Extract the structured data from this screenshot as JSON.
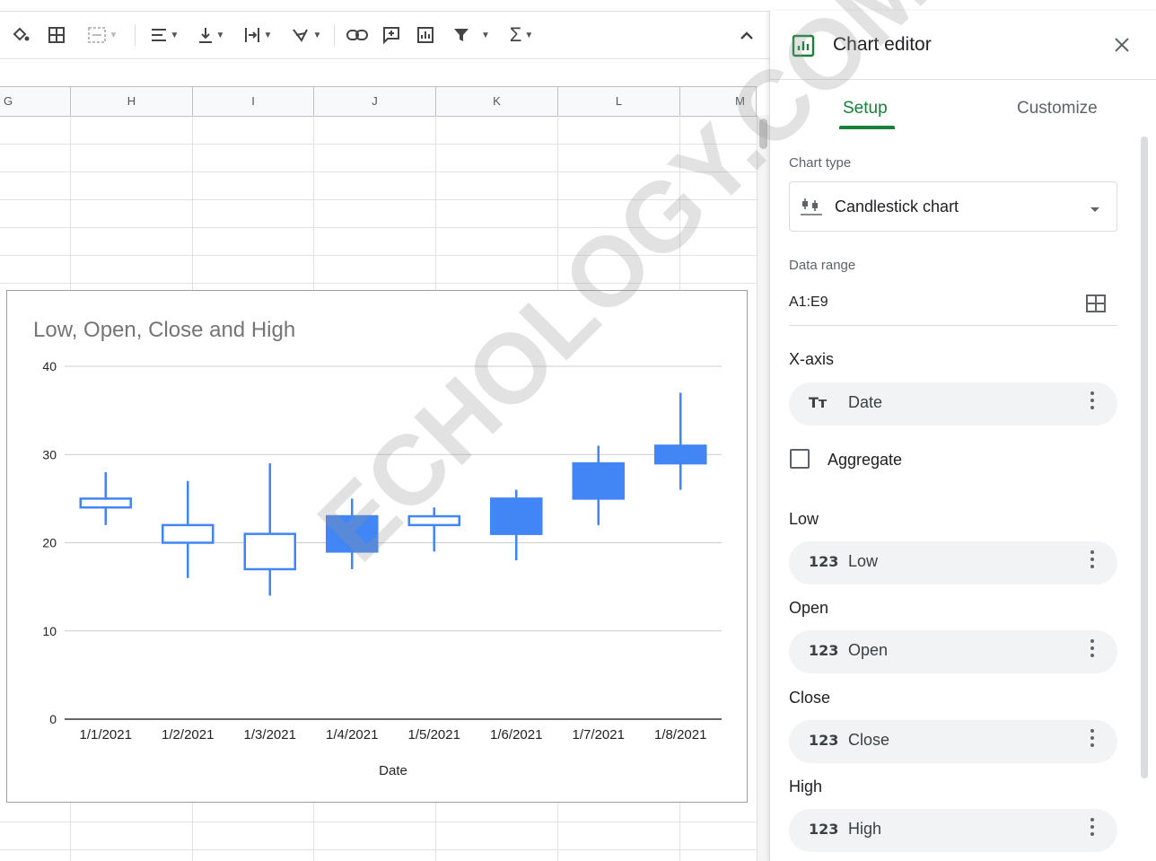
{
  "toolbar": {
    "icons": [
      "fill-color-icon",
      "borders-icon",
      "merge-cells-icon",
      "horizontal-align-icon",
      "vertical-align-icon",
      "text-wrap-icon",
      "text-rotation-icon",
      "insert-link-icon",
      "insert-comment-icon",
      "insert-chart-icon",
      "filter-icon",
      "functions-icon",
      "collapse-chevron-icon"
    ]
  },
  "columns": [
    "G",
    "H",
    "I",
    "J",
    "K",
    "L",
    "M"
  ],
  "chart": {
    "title": "Low, Open, Close and High",
    "xlabel": "Date",
    "accent": "#4285f4"
  },
  "chart_data": {
    "type": "candlestick",
    "title": "Low, Open, Close and High",
    "xlabel": "Date",
    "ylabel": "",
    "ylim": [
      0,
      40
    ],
    "yticks": [
      0,
      10,
      20,
      30,
      40
    ],
    "categories": [
      "1/1/2021",
      "1/2/2021",
      "1/3/2021",
      "1/4/2021",
      "1/5/2021",
      "1/6/2021",
      "1/7/2021",
      "1/8/2021"
    ],
    "low": [
      22,
      16,
      14,
      17,
      19,
      18,
      22,
      26
    ],
    "open": [
      25,
      22,
      21,
      19,
      23,
      21,
      25,
      29
    ],
    "close": [
      24,
      20,
      17,
      23,
      22,
      25,
      29,
      31
    ],
    "high": [
      28,
      27,
      29,
      25,
      24,
      26,
      31,
      37
    ],
    "grid": true,
    "legend": "none"
  },
  "panel": {
    "title": "Chart editor",
    "tabs": [
      "Setup",
      "Customize"
    ],
    "active_tab": "Setup",
    "accent": "#188038",
    "chart_type_label": "Chart type",
    "chart_type_value": "Candlestick chart",
    "data_range_label": "Data range",
    "data_range_value": "A1:E9",
    "xaxis_label": "X-axis",
    "xaxis_chip": "Date",
    "xaxis_chip_icon": "Tт",
    "aggregate_label": "Aggregate",
    "aggregate_checked": false,
    "series": [
      {
        "section": "Low",
        "chip": "Low",
        "icon": "123"
      },
      {
        "section": "Open",
        "chip": "Open",
        "icon": "123"
      },
      {
        "section": "Close",
        "chip": "Close",
        "icon": "123"
      },
      {
        "section": "High",
        "chip": "High",
        "icon": "123"
      }
    ]
  },
  "watermark": "ECHOLOGY.COM"
}
